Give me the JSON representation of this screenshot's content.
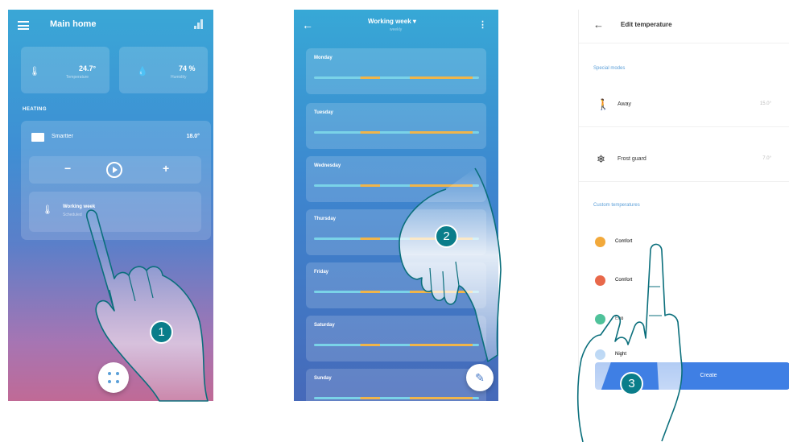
{
  "screen1": {
    "title": "Main home",
    "temperature": {
      "value": "24.7°",
      "sub": "Temperature"
    },
    "humidity": {
      "value": "74 %",
      "sub": "Humidity"
    },
    "section_label": "HEATING",
    "zone": {
      "name": "Smartter",
      "temp": "18.0°"
    },
    "controls": {
      "minus": "−",
      "plus": "+"
    },
    "program": {
      "name": "Working week",
      "sub": "Scheduled"
    },
    "icons": {
      "menu": "menu-icon",
      "signal": "signal-icon",
      "thermometer": "thermometer-icon",
      "drop": "drop-icon",
      "play": "play-icon",
      "dots": "dots-icon"
    }
  },
  "screen2": {
    "title": "Working week ▾",
    "subtitle": "weekly",
    "back": "←",
    "more": "⋮",
    "days": [
      "Monday",
      "Tuesday",
      "Wednesday",
      "Thursday",
      "Friday",
      "Saturday",
      "Sunday"
    ],
    "fab": "✎",
    "colors": {
      "comfort": "#f0b54a",
      "eco": "#7ad3e8"
    }
  },
  "screen3": {
    "back": "←",
    "title": "Edit temperature",
    "special_section": "Special modes",
    "special_modes": [
      {
        "label": "Away",
        "value": "15.0°",
        "icon": "away-icon"
      },
      {
        "label": "Frost guard",
        "value": "7.0°",
        "icon": "snowflake-icon"
      }
    ],
    "custom_section": "Custom temperatures",
    "custom": [
      {
        "label": "Comfort",
        "color": "#f2a93b"
      },
      {
        "label": "Comfort",
        "color": "#e8684a"
      },
      {
        "label": "Eco",
        "color": "#4fc29a"
      },
      {
        "label": "Night",
        "color": "#6aa8e8"
      }
    ],
    "button": "Create"
  },
  "steps": [
    "1",
    "2",
    "3"
  ]
}
